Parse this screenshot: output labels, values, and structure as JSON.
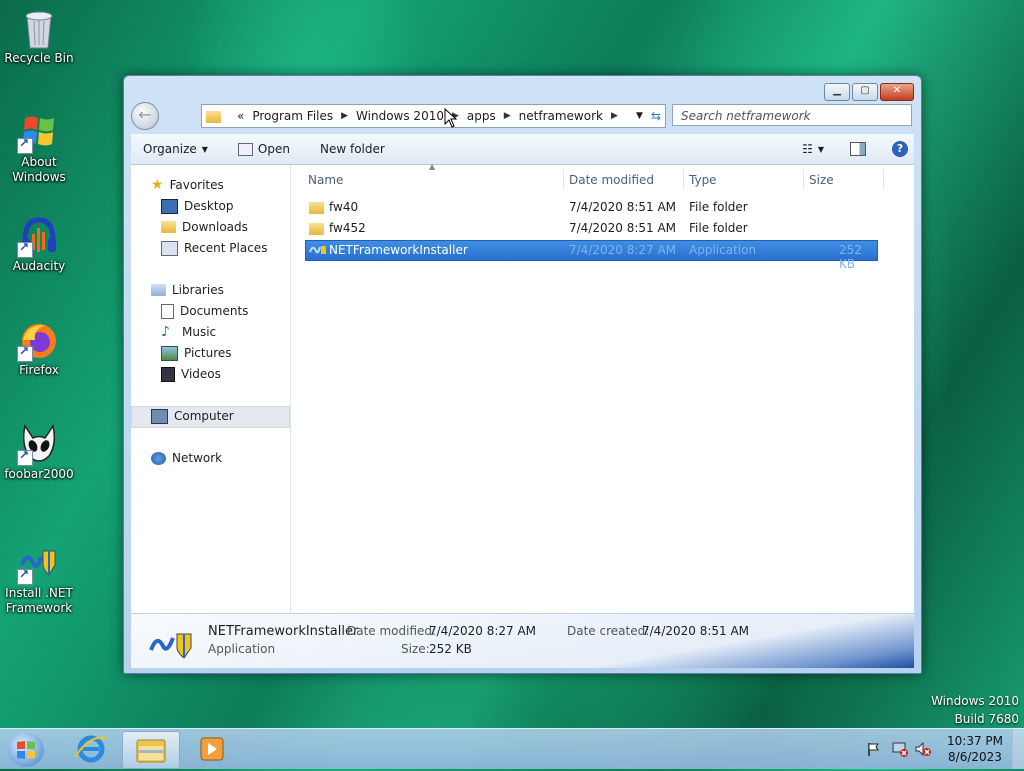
{
  "desktop": {
    "icons": [
      {
        "label": "Recycle Bin"
      },
      {
        "label": "About\nWindows"
      },
      {
        "label": "Audacity"
      },
      {
        "label": "Firefox"
      },
      {
        "label": "foobar2000"
      },
      {
        "label": "Install .NET\nFramework"
      }
    ],
    "watermark": {
      "line1": "Windows 2010",
      "line2": "Build 7680"
    }
  },
  "window": {
    "address": {
      "overflow": "«",
      "crumbs": [
        "Program Files",
        "Windows 2010",
        "apps",
        "netframework"
      ]
    },
    "search_placeholder": "Search netframework",
    "toolbar": {
      "organize": "Organize",
      "open": "Open",
      "new_folder": "New folder"
    },
    "nav": {
      "favorites": "Favorites",
      "desktop": "Desktop",
      "downloads": "Downloads",
      "recent_places": "Recent Places",
      "libraries": "Libraries",
      "documents": "Documents",
      "music": "Music",
      "pictures": "Pictures",
      "videos": "Videos",
      "computer": "Computer",
      "network": "Network"
    },
    "columns": {
      "name": "Name",
      "date": "Date modified",
      "type": "Type",
      "size": "Size"
    },
    "files": [
      {
        "name": "fw40",
        "date": "7/4/2020 8:51 AM",
        "type": "File folder",
        "size": ""
      },
      {
        "name": "fw452",
        "date": "7/4/2020 8:51 AM",
        "type": "File folder",
        "size": ""
      },
      {
        "name": "NETFrameworkInstaller",
        "date": "7/4/2020 8:27 AM",
        "type": "Application",
        "size": "252 KB"
      }
    ],
    "details": {
      "name": "NETFrameworkInstaller",
      "type": "Application",
      "date_modified_label": "Date modified:",
      "date_modified": "7/4/2020 8:27 AM",
      "date_created_label": "Date created:",
      "date_created": "7/4/2020 8:51 AM",
      "size_label": "Size:",
      "size": "252 KB"
    }
  },
  "taskbar": {
    "time": "10:37 PM",
    "date": "8/6/2023"
  }
}
